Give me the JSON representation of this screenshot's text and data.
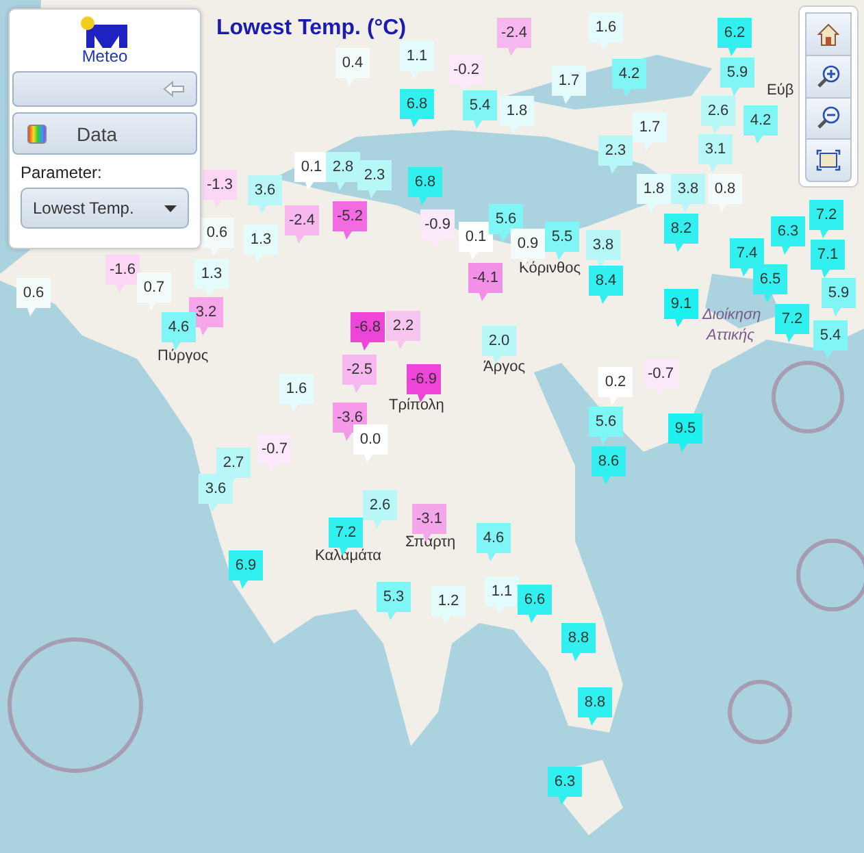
{
  "map": {
    "title": "Lowest Temp. (°C)",
    "place_labels": [
      {
        "text": "Εύβ"
      },
      {
        "text": "Κόρινθος"
      },
      {
        "text": "Διοίκηση"
      },
      {
        "text": "Αττικής"
      },
      {
        "text": "Πύργος"
      },
      {
        "text": "Άργος"
      },
      {
        "text": "Τρίπολη"
      },
      {
        "text": "Καλαμάτα"
      },
      {
        "text": "Σπάρτη"
      }
    ],
    "markers": [
      {
        "value": "0.4",
        "color": "#f4fbfb"
      },
      {
        "value": "1.1",
        "color": "#e3fbfb"
      },
      {
        "value": "-0.2",
        "color": "#fbe8f8"
      },
      {
        "value": "-2.4",
        "color": "#f7b8ef"
      },
      {
        "value": "1.6",
        "color": "#e3fbfb"
      },
      {
        "value": "1.7",
        "color": "#e3fbfb"
      },
      {
        "value": "4.2",
        "color": "#7ff5f5"
      },
      {
        "value": "6.8",
        "color": "#33f0f0"
      },
      {
        "value": "5.4",
        "color": "#7ff5f5"
      },
      {
        "value": "1.8",
        "color": "#e3fbfb"
      },
      {
        "value": "6.2",
        "color": "#33f0f0"
      },
      {
        "value": "5.9",
        "color": "#7ff5f5"
      },
      {
        "value": "2.6",
        "color": "#b8f7f7"
      },
      {
        "value": "4.2",
        "color": "#7ff5f5"
      },
      {
        "value": "1.7",
        "color": "#e3fbfb"
      },
      {
        "value": "2.3",
        "color": "#b8f7f7"
      },
      {
        "value": "3.1",
        "color": "#b8f7f7"
      },
      {
        "value": "1.8",
        "color": "#e3fbfb"
      },
      {
        "value": "3.8",
        "color": "#b8f7f7"
      },
      {
        "value": "0.8",
        "color": "#f4fbfb"
      },
      {
        "value": "8.2",
        "color": "#33f0f0"
      },
      {
        "value": "7.4",
        "color": "#33f0f0"
      },
      {
        "value": "6.3",
        "color": "#33f0f0"
      },
      {
        "value": "7.2",
        "color": "#33f0f0"
      },
      {
        "value": "7.1",
        "color": "#33f0f0"
      },
      {
        "value": "6.5",
        "color": "#33f0f0"
      },
      {
        "value": "5.9",
        "color": "#7ff5f5"
      },
      {
        "value": "7.2",
        "color": "#33f0f0"
      },
      {
        "value": "5.4",
        "color": "#7ff5f5"
      },
      {
        "value": "9.1",
        "color": "#1ef0f0"
      },
      {
        "value": "6.8",
        "color": "#33f0f0"
      },
      {
        "value": "0.1",
        "color": "#ffffff"
      },
      {
        "value": "2.8",
        "color": "#b8f7f7"
      },
      {
        "value": "2.3",
        "color": "#b8f7f7"
      },
      {
        "value": "3.6",
        "color": "#b8f7f7"
      },
      {
        "value": "-1.3",
        "color": "#fbd6f5"
      },
      {
        "value": "-2.4",
        "color": "#f7b8ef"
      },
      {
        "value": "-5.2",
        "color": "#f26be0"
      },
      {
        "value": "0.6",
        "color": "#f4fbfb"
      },
      {
        "value": "1.3",
        "color": "#e3fbfb"
      },
      {
        "value": "-0.9",
        "color": "#fbe8f8"
      },
      {
        "value": "0.1",
        "color": "#ffffff"
      },
      {
        "value": "5.6",
        "color": "#7ff5f5"
      },
      {
        "value": "0.9",
        "color": "#f4fbfb"
      },
      {
        "value": "5.5",
        "color": "#7ff5f5"
      },
      {
        "value": "3.8",
        "color": "#b8f7f7"
      },
      {
        "value": "-4.1",
        "color": "#f28fe6"
      },
      {
        "value": "8.4",
        "color": "#33f0f0"
      },
      {
        "value": "2.0",
        "color": "#b8f7f7"
      },
      {
        "value": "-1.6",
        "color": "#fbd6f5"
      },
      {
        "value": "0.6",
        "color": "#f4fbfb"
      },
      {
        "value": "0.7",
        "color": "#f4fbfb"
      },
      {
        "value": "1.3",
        "color": "#e3fbfb"
      },
      {
        "value": "3.2",
        "color": "#f7a6ec"
      },
      {
        "value": "4.6",
        "color": "#7ff5f5"
      },
      {
        "value": "-6.8",
        "color": "#ee45d8"
      },
      {
        "value": "2.2",
        "color": "#f7c6f0"
      },
      {
        "value": "-2.5",
        "color": "#f7b8ef"
      },
      {
        "value": "-6.9",
        "color": "#ee45d8"
      },
      {
        "value": "1.6",
        "color": "#e3fbfb"
      },
      {
        "value": "-3.6",
        "color": "#f49ae8"
      },
      {
        "value": "0.0",
        "color": "#ffffff"
      },
      {
        "value": "-0.7",
        "color": "#fbe8f8"
      },
      {
        "value": "2.7",
        "color": "#b8f7f7"
      },
      {
        "value": "3.6",
        "color": "#b8f7f7"
      },
      {
        "value": "2.6",
        "color": "#b8f7f7"
      },
      {
        "value": "7.2",
        "color": "#33f0f0"
      },
      {
        "value": "-3.1",
        "color": "#f4a6ea"
      },
      {
        "value": "6.9",
        "color": "#33f0f0"
      },
      {
        "value": "0.2",
        "color": "#ffffff"
      },
      {
        "value": "-0.7",
        "color": "#fbe8f8"
      },
      {
        "value": "5.6",
        "color": "#7ff5f5"
      },
      {
        "value": "8.6",
        "color": "#33f0f0"
      },
      {
        "value": "9.5",
        "color": "#1ef0f0"
      },
      {
        "value": "4.6",
        "color": "#7ff5f5"
      },
      {
        "value": "5.3",
        "color": "#7ff5f5"
      },
      {
        "value": "1.2",
        "color": "#e3fbfb"
      },
      {
        "value": "1.1",
        "color": "#e3fbfb"
      },
      {
        "value": "6.6",
        "color": "#33f0f0"
      },
      {
        "value": "8.8",
        "color": "#33f0f0"
      },
      {
        "value": "8.8",
        "color": "#33f0f0"
      },
      {
        "value": "6.3",
        "color": "#33f0f0"
      }
    ]
  },
  "panel": {
    "logo_text": "Meteo",
    "data_button": "Data",
    "parameter_label": "Parameter:",
    "parameter_value": "Lowest Temp."
  }
}
